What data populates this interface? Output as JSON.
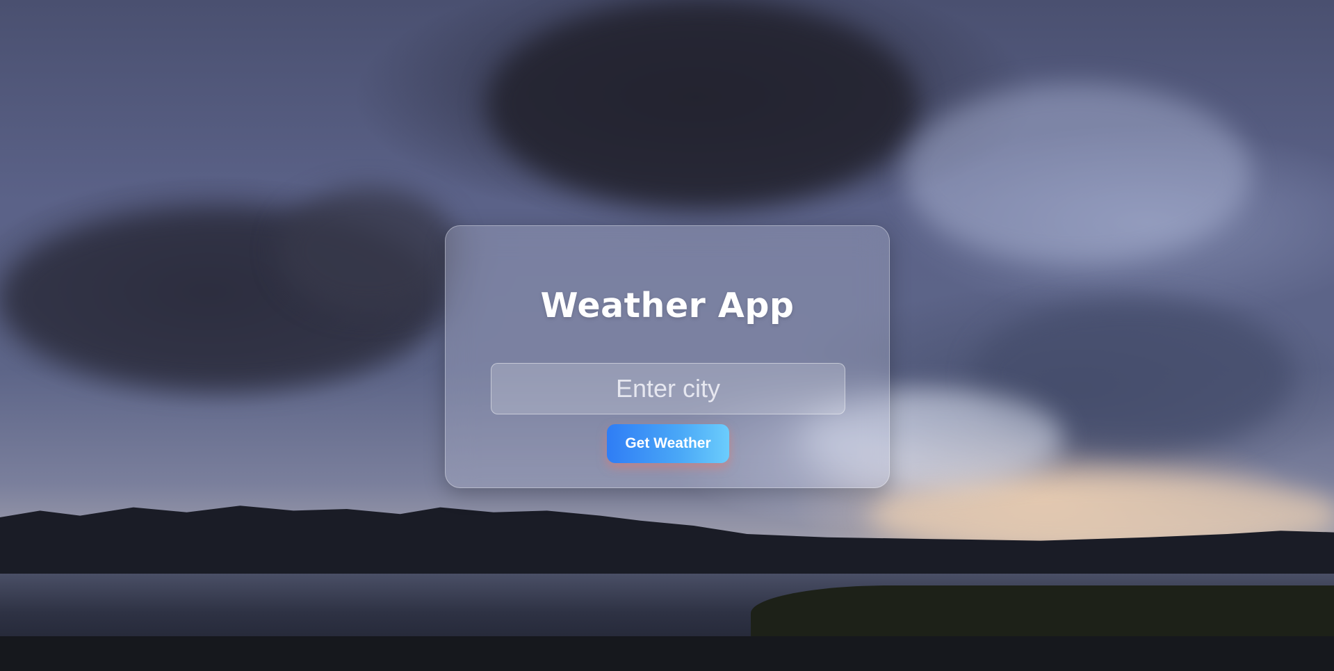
{
  "app": {
    "title": "Weather App"
  },
  "search": {
    "placeholder": "Enter city",
    "value": ""
  },
  "actions": {
    "get_weather_label": "Get Weather"
  },
  "colors": {
    "button_gradient_start": "#2f7df5",
    "button_gradient_end": "#6ccdfc",
    "title_text": "#ffffff",
    "card_glass": "rgba(200,205,225,0.28)"
  }
}
